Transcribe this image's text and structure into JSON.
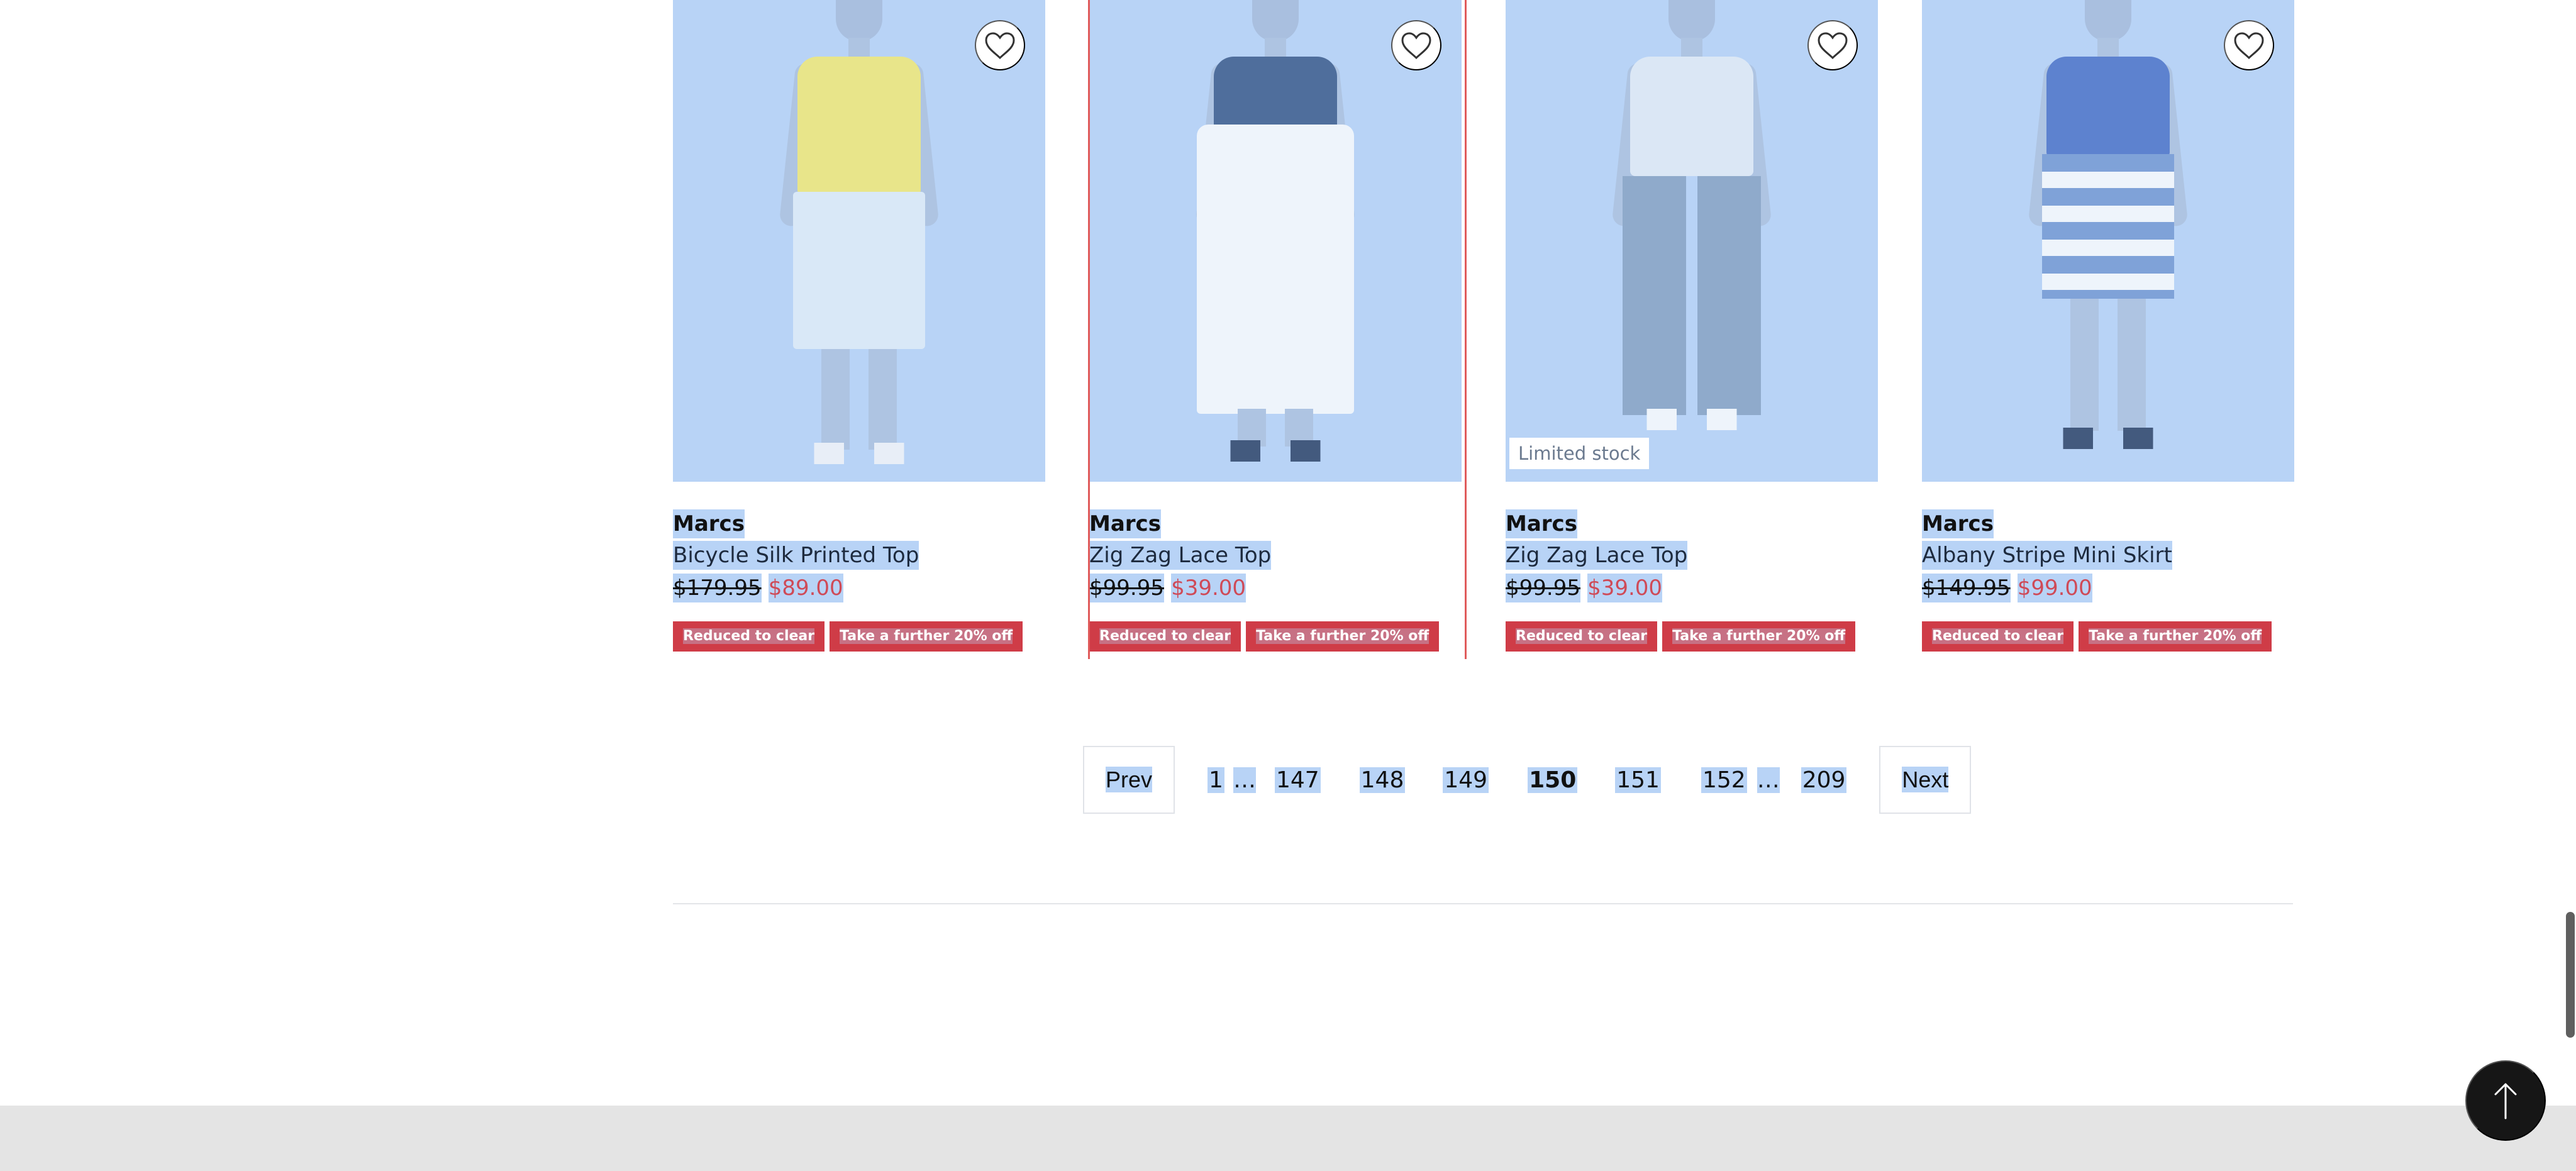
{
  "products": [
    {
      "brand": "Marcs",
      "name": "Bicycle Silk Printed Top",
      "old_price": "$179.95",
      "new_price": "$89.00",
      "badges": [
        "Reduced to clear",
        "Take a further 20% off"
      ],
      "image": "model wearing yellow sleeveless top and white skirt",
      "top_color": "#e8e58a",
      "bottom_color": "#d9e8f7",
      "bottom_style": "skirt"
    },
    {
      "brand": "Marcs",
      "name": "Zig Zag Lace Top",
      "old_price": "$99.95",
      "new_price": "$39.00",
      "badges": [
        "Reduced to clear",
        "Take a further 20% off"
      ],
      "image": "model wearing navy lace top and white printed midi skirt",
      "top_color": "#4f6e9c",
      "bottom_color": "#eef4fb",
      "bottom_style": "midi"
    },
    {
      "brand": "Marcs",
      "name": "Zig Zag Lace Top",
      "old_price": "$99.95",
      "new_price": "$39.00",
      "badges": [
        "Reduced to clear",
        "Take a further 20% off"
      ],
      "stock_label": "Limited stock",
      "image": "model wearing white lace top and blue wide leg pants",
      "top_color": "#dbe7f5",
      "bottom_color": "#8faacb",
      "bottom_style": "pants"
    },
    {
      "brand": "Marcs",
      "name": "Albany Stripe Mini Skirt",
      "old_price": "$149.95",
      "new_price": "$99.00",
      "badges": [
        "Reduced to clear",
        "Take a further 20% off"
      ],
      "image": "model wearing blue top and striped mini skirt",
      "top_color": "#5d82cf",
      "bottom_color": "#7fa2d8",
      "bottom_style": "stripe"
    }
  ],
  "pagination": {
    "prev": "Prev",
    "next": "Next",
    "pages": [
      "1",
      "…",
      "147",
      "148",
      "149",
      "150",
      "151",
      "152",
      "…",
      "209"
    ],
    "current": "150"
  },
  "icons": {
    "wishlist": "heart-icon",
    "back_to_top": "arrow-up-icon"
  }
}
